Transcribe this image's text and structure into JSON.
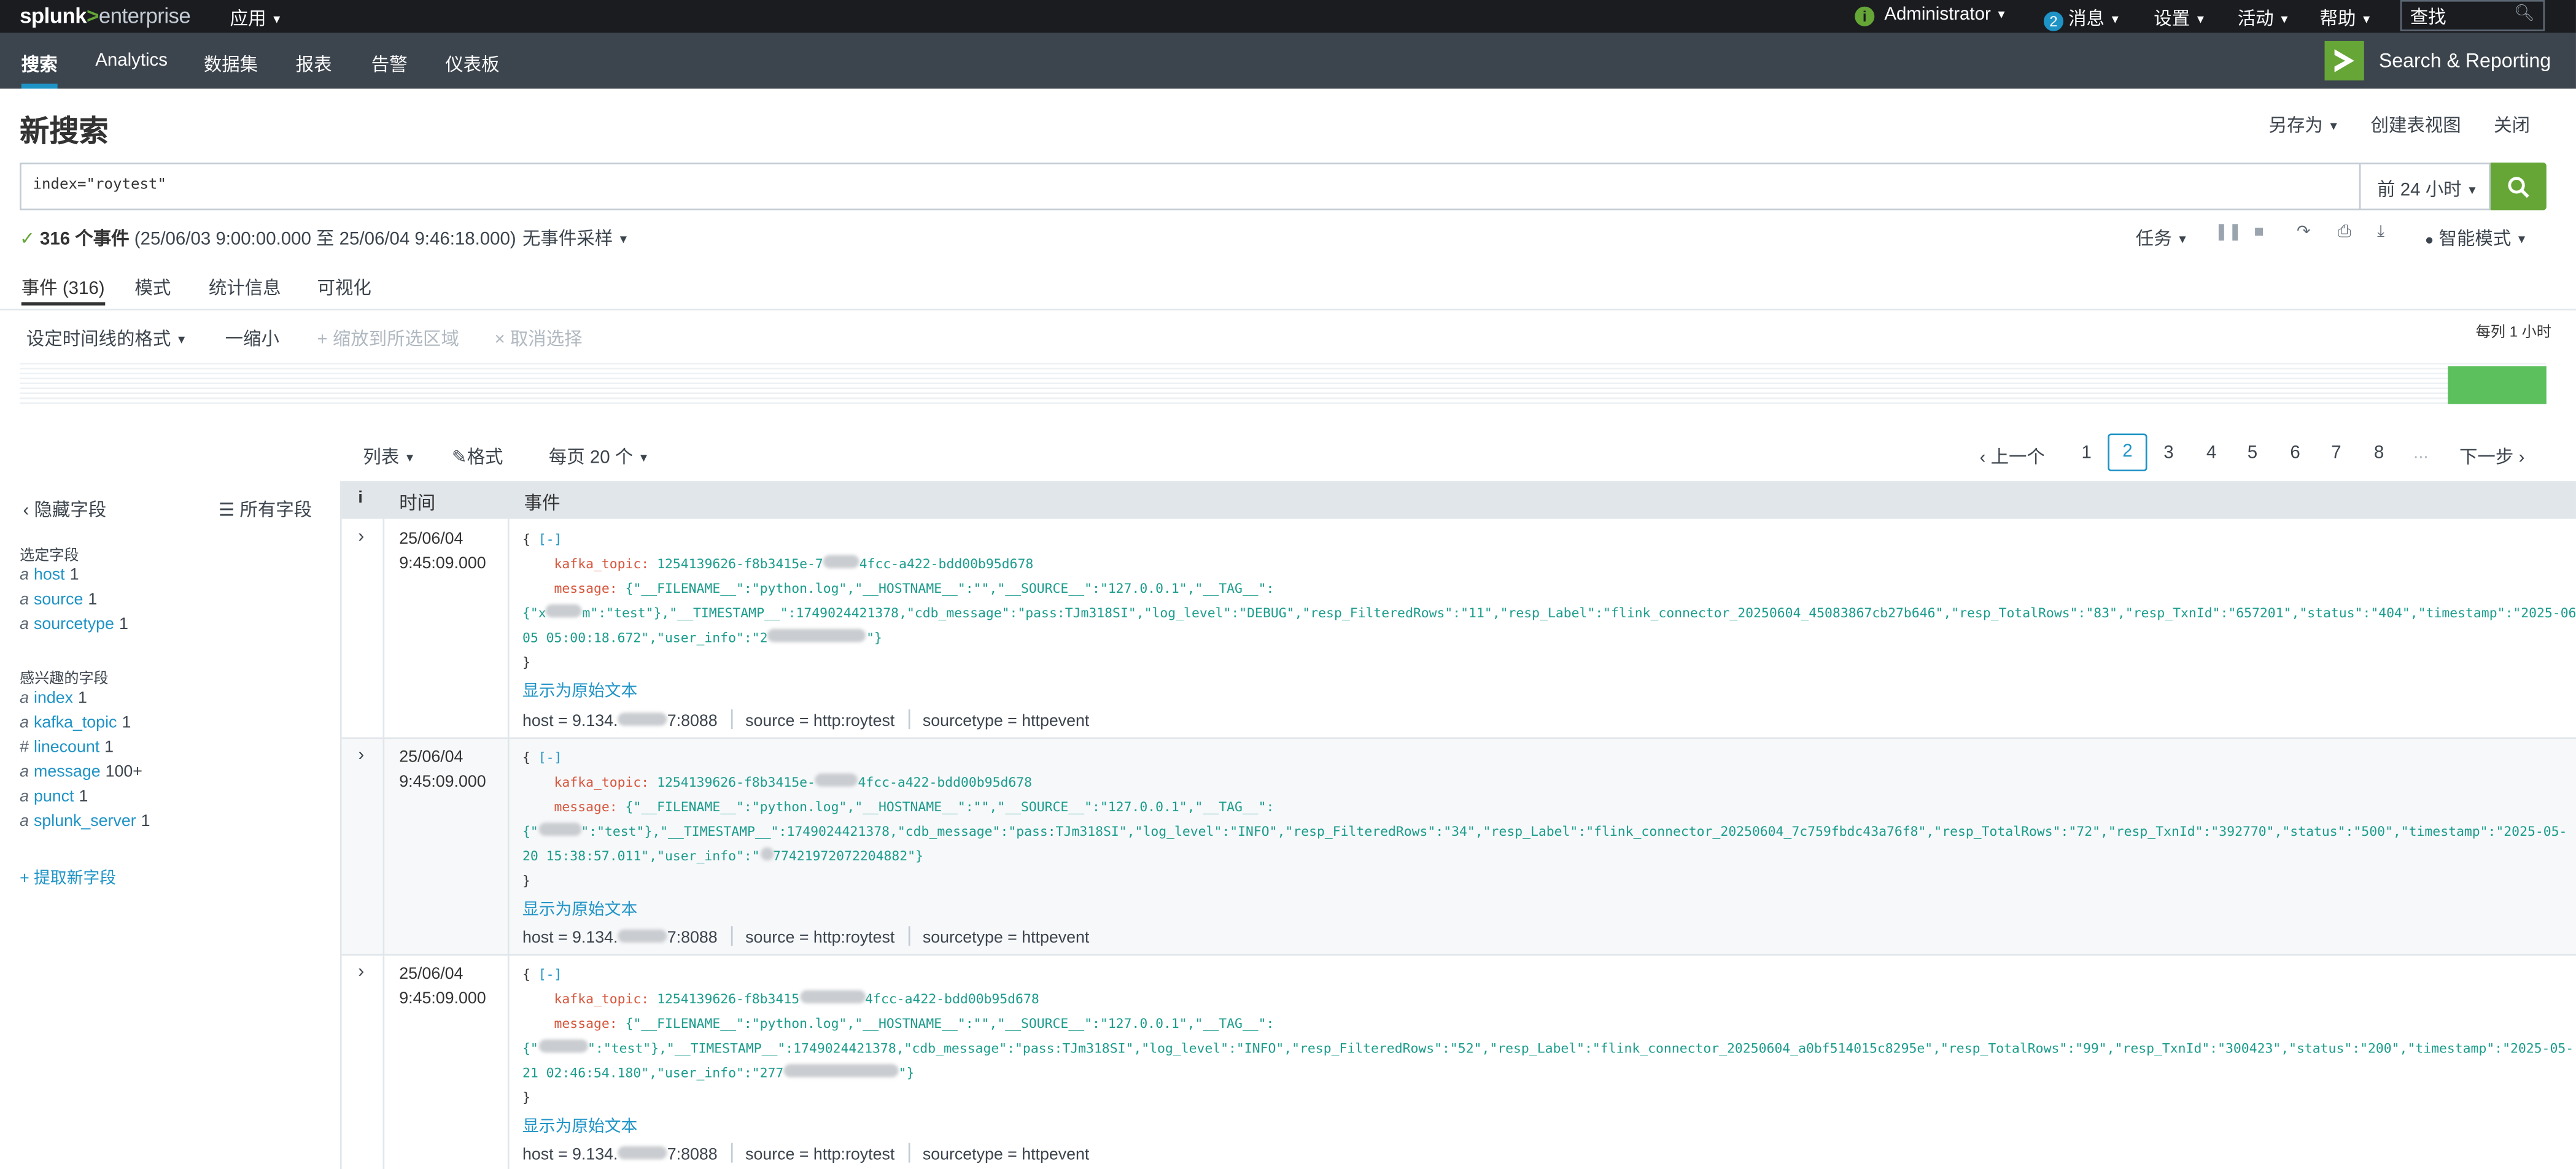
{
  "topbar": {
    "logo_splunk": "splunk",
    "logo_gt": ">",
    "logo_product": "enterprise",
    "apps": "应用",
    "user": "Administrator",
    "messages_count": "2",
    "messages": "消息",
    "settings": "设置",
    "activity": "活动",
    "help": "帮助",
    "find_placeholder": "查找"
  },
  "appbar": {
    "nav": [
      "搜索",
      "Analytics",
      "数据集",
      "报表",
      "告警",
      "仪表板"
    ],
    "app_title": "Search & Reporting"
  },
  "header": {
    "title": "新搜索",
    "save_as": "另存为",
    "create_table_view": "创建表视图",
    "close": "关闭"
  },
  "search": {
    "query": "index=\"roytest\"",
    "time_range": "前 24 小时"
  },
  "status": {
    "check": "✓",
    "count_text": "316 个事件",
    "range_text": "(25/06/03 9:00:00.000 至 25/06/04 9:46:18.000)",
    "sampling": "无事件采样",
    "job": "任务",
    "mode": "智能模式"
  },
  "tabs": [
    "事件 (316)",
    "模式",
    "统计信息",
    "可视化"
  ],
  "timeline": {
    "format": "设定时间线的格式",
    "zoom_out": "一缩小",
    "zoom_selection": "+ 缩放到所选区域",
    "deselect": "× 取消选择",
    "per_column": "每列 1 小时",
    "bucket_fraction": 1.0
  },
  "list_controls": {
    "list": "列表",
    "format": "格式",
    "per_page": "每页 20 个"
  },
  "pagination": {
    "prev": "上一个",
    "pages": [
      "1",
      "2",
      "3",
      "4",
      "5",
      "6",
      "7",
      "8"
    ],
    "current": "2",
    "ellipsis": "...",
    "next": "下一步"
  },
  "sidebar": {
    "hide_fields": "隐藏字段",
    "all_fields": "所有字段",
    "selected_title": "选定字段",
    "selected": [
      {
        "type": "a",
        "name": "host",
        "count": "1"
      },
      {
        "type": "a",
        "name": "source",
        "count": "1"
      },
      {
        "type": "a",
        "name": "sourcetype",
        "count": "1"
      }
    ],
    "interesting_title": "感兴趣的字段",
    "interesting": [
      {
        "type": "a",
        "name": "index",
        "count": "1"
      },
      {
        "type": "a",
        "name": "kafka_topic",
        "count": "1"
      },
      {
        "type": "#",
        "name": "linecount",
        "count": "1"
      },
      {
        "type": "a",
        "name": "message",
        "count": "100+"
      },
      {
        "type": "a",
        "name": "punct",
        "count": "1"
      },
      {
        "type": "a",
        "name": "splunk_server",
        "count": "1"
      }
    ],
    "extract": "+ 提取新字段"
  },
  "table": {
    "col_info": "i",
    "col_time": "时间",
    "col_event": "事件"
  },
  "events": [
    {
      "date": "25/06/04",
      "time": "9:45:09.000",
      "open": "{ ",
      "collapse": "[-]",
      "topic_key": "kafka_topic:",
      "topic_val_a": "1254139626-f8b3415e-7",
      "topic_val_b": "4fcc-a422-bdd00b95d678",
      "msg_key": "message:",
      "msg_line1": "{\"__FILENAME__\":\"python.log\",\"__HOSTNAME__\":\"\",\"__SOURCE__\":\"127.0.0.1\",\"__TAG__\":",
      "msg_line2_a": "{\"x",
      "msg_line2_b": "m\":\"test\"},\"__TIMESTAMP__\":1749024421378,\"cdb_message\":\"pass:TJm318SI\",\"log_level\":\"DEBUG\",\"resp_FilteredRows\":\"11\",\"resp_Label\":\"flink_connector_20250604_45083867cb27b646\",\"resp_TotalRows\":\"83\",\"resp_TxnId\":\"657201\",\"status\":\"404\",\"timestamp\":\"2025-06-",
      "msg_line3_a": "05 05:00:18.672\",\"user_info\":\"2",
      "msg_line3_b": "\"}",
      "close": "}",
      "raw": "显示为原始文本",
      "host_a": "host = 9.134.",
      "host_b": "7:8088",
      "source": "source = http:roytest",
      "sourcetype": "sourcetype = httpevent"
    },
    {
      "date": "25/06/04",
      "time": "9:45:09.000",
      "open": "{ ",
      "collapse": "[-]",
      "topic_key": "kafka_topic:",
      "topic_val_a": "1254139626-f8b3415e-",
      "topic_val_b": "4fcc-a422-bdd00b95d678",
      "msg_key": "message:",
      "msg_line1": "{\"__FILENAME__\":\"python.log\",\"__HOSTNAME__\":\"\",\"__SOURCE__\":\"127.0.0.1\",\"__TAG__\":",
      "msg_line2_a": "{\"",
      "msg_line2_b": "\":\"test\"},\"__TIMESTAMP__\":1749024421378,\"cdb_message\":\"pass:TJm318SI\",\"log_level\":\"INFO\",\"resp_FilteredRows\":\"34\",\"resp_Label\":\"flink_connector_20250604_7c759fbdc43a76f8\",\"resp_TotalRows\":\"72\",\"resp_TxnId\":\"392770\",\"status\":\"500\",\"timestamp\":\"2025-05-",
      "msg_line3_a": "20 15:38:57.011\",\"user_info\":\"",
      "msg_line3_b": "77421972072204882\"}",
      "close": "}",
      "raw": "显示为原始文本",
      "host_a": "host = 9.134.",
      "host_b": "7:8088",
      "source": "source = http:roytest",
      "sourcetype": "sourcetype = httpevent"
    },
    {
      "date": "25/06/04",
      "time": "9:45:09.000",
      "open": "{ ",
      "collapse": "[-]",
      "topic_key": "kafka_topic:",
      "topic_val_a": "1254139626-f8b3415",
      "topic_val_b": "4fcc-a422-bdd00b95d678",
      "msg_key": "message:",
      "msg_line1": "{\"__FILENAME__\":\"python.log\",\"__HOSTNAME__\":\"\",\"__SOURCE__\":\"127.0.0.1\",\"__TAG__\":",
      "msg_line2_a": "{\"",
      "msg_line2_b": "\":\"test\"},\"__TIMESTAMP__\":1749024421378,\"cdb_message\":\"pass:TJm318SI\",\"log_level\":\"INFO\",\"resp_FilteredRows\":\"52\",\"resp_Label\":\"flink_connector_20250604_a0bf514015c8295e\",\"resp_TotalRows\":\"99\",\"resp_TxnId\":\"300423\",\"status\":\"200\",\"timestamp\":\"2025-05-",
      "msg_line3_a": "21 02:46:54.180\",\"user_info\":\"277",
      "msg_line3_b": "\"}",
      "close": "}",
      "raw": "显示为原始文本",
      "host_a": "host = 9.134.",
      "host_b": "7:8088",
      "source": "source = http:roytest",
      "sourcetype": "sourcetype = httpevent"
    }
  ]
}
